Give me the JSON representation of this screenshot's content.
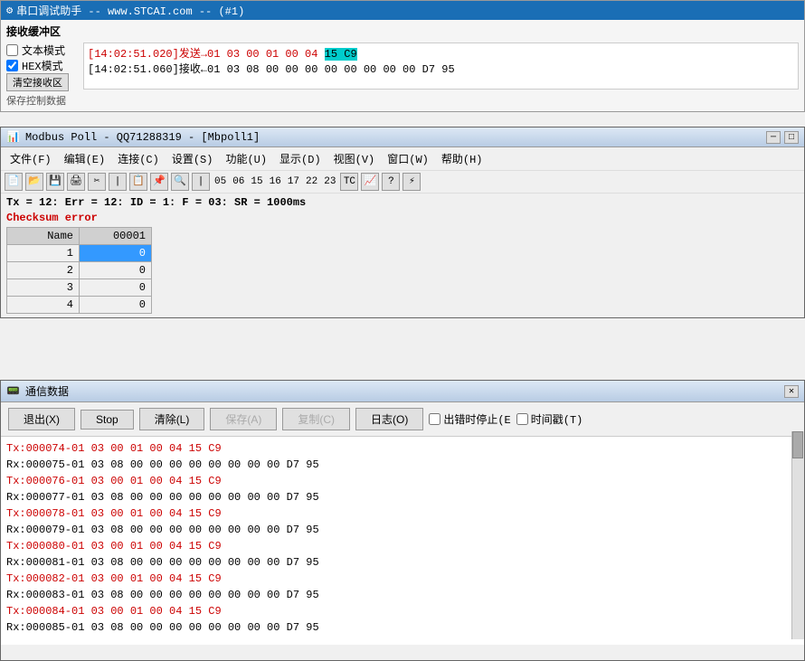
{
  "serial": {
    "title": "串口调试助手 -- www.STCAI.com -- (#1)",
    "section": "接收缓冲区",
    "text_mode_label": "文本模式",
    "hex_mode_label": "HEX模式",
    "clear_btn": "清空接收区",
    "other_label": "保存控制数据",
    "log_lines": [
      {
        "text_before": "[14:02:51.020]发送→01 03 00 01 00 04 ",
        "highlight": "15 C9",
        "text_after": "",
        "type": "send"
      },
      {
        "text": "[14:02:51.060]接收←01 03 08 00 00 00 00 00 00 00 00 D7 95",
        "type": "recv"
      }
    ]
  },
  "modbus": {
    "title": "Modbus Poll - QQ71288319 - [Mbpoll1]",
    "menus": [
      "文件(F)",
      "编辑(E)",
      "连接(C)",
      "设置(S)",
      "功能(U)",
      "显示(D)",
      "视图(V)",
      "窗口(W)",
      "帮助(H)"
    ],
    "toolbar_labels": [
      "05",
      "06",
      "15",
      "16",
      "17",
      "22",
      "23",
      "TC"
    ],
    "status": "Tx = 12: Err = 12: ID = 1: F = 03: SR = 1000ms",
    "error": "Checksum error",
    "table": {
      "headers": [
        "Name",
        "00001"
      ],
      "rows": [
        {
          "index": "1",
          "name": "",
          "value": "0",
          "selected": true
        },
        {
          "index": "2",
          "name": "",
          "value": "0",
          "selected": false
        },
        {
          "index": "3",
          "name": "",
          "value": "0",
          "selected": false
        },
        {
          "index": "4",
          "name": "",
          "value": "0",
          "selected": false
        }
      ]
    }
  },
  "comm": {
    "title": "通信数据",
    "btns": {
      "exit": "退出(X)",
      "stop": "Stop",
      "clear": "清除(L)",
      "save": "保存(A)",
      "copy": "复制(C)",
      "log": "日志(O)"
    },
    "checkbox1": "出错时停止(E",
    "checkbox2": "时间戳(T)",
    "log_lines": [
      {
        "text": "Tx:000074-01 03 00 01 00 04 15 C9",
        "type": "tx"
      },
      {
        "text": "Rx:000075-01 03 08 00 00 00 00 00 00 00 00 D7 95",
        "type": "rx"
      },
      {
        "text": "Tx:000076-01 03 00 01 00 04 15 C9",
        "type": "tx"
      },
      {
        "text": "Rx:000077-01 03 08 00 00 00 00 00 00 00 00 D7 95",
        "type": "rx"
      },
      {
        "text": "Tx:000078-01 03 00 01 00 04 15 C9",
        "type": "tx"
      },
      {
        "text": "Rx:000079-01 03 08 00 00 00 00 00 00 00 00 D7 95",
        "type": "rx"
      },
      {
        "text": "Tx:000080-01 03 00 01 00 04 15 C9",
        "type": "tx"
      },
      {
        "text": "Rx:000081-01 03 08 00 00 00 00 00 00 00 00 D7 95",
        "type": "rx"
      },
      {
        "text": "Tx:000082-01 03 00 01 00 04 15 C9",
        "type": "tx"
      },
      {
        "text": "Rx:000083-01 03 08 00 00 00 00 00 00 00 00 D7 95",
        "type": "rx"
      },
      {
        "text": "Tx:000084-01 03 00 01 00 04 15 C9",
        "type": "tx"
      },
      {
        "text": "Rx:000085-01 03 08 00 00 00 00 00 00 00 00 D7 95",
        "type": "rx"
      }
    ]
  }
}
